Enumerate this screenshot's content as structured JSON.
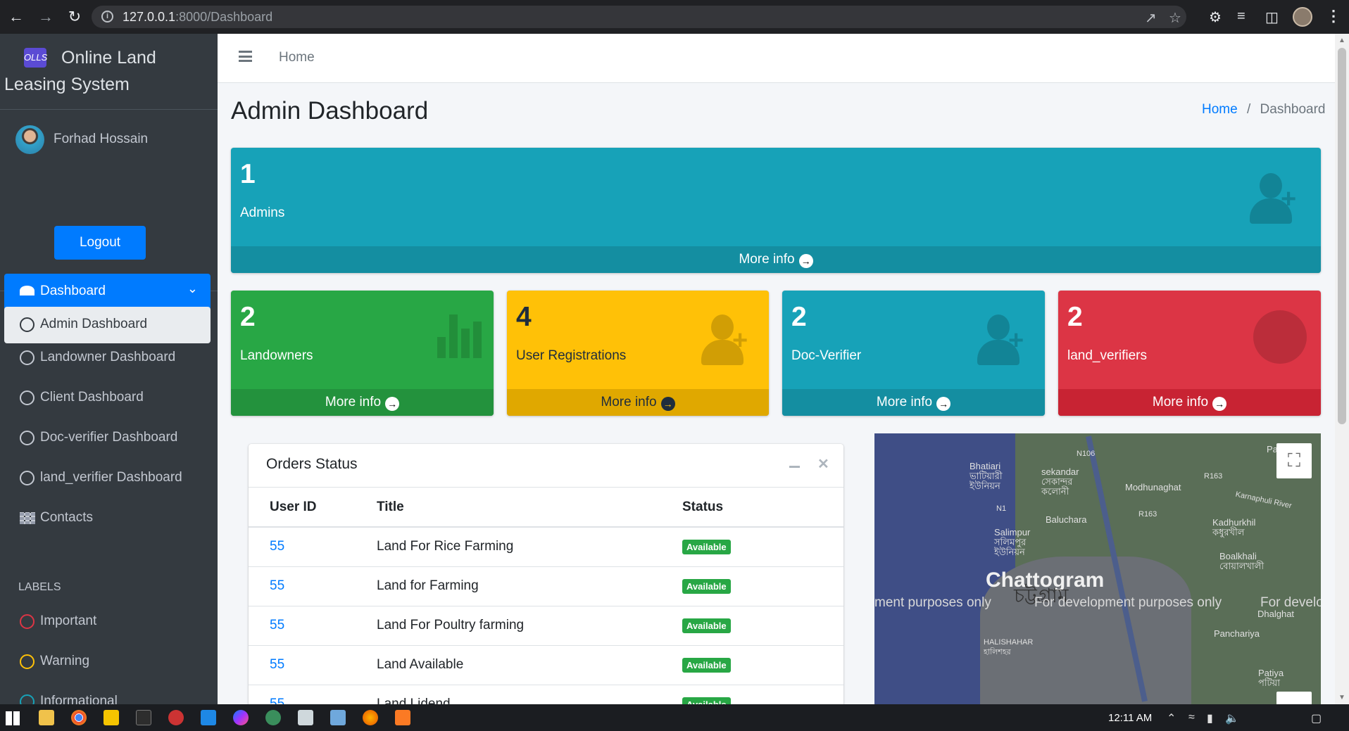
{
  "browser": {
    "url_host": "127.0.0.1",
    "url_rest": ":8000/Dashboard"
  },
  "brand": {
    "logo_text": "OLLS",
    "title_line1": "Online Land",
    "title_line2": "Leasing System"
  },
  "user": {
    "name": "Forhad Hossain",
    "logout_label": "Logout"
  },
  "sidebar": {
    "dashboard_label": "Dashboard",
    "items": [
      {
        "label": "Admin Dashboard"
      },
      {
        "label": "Landowner Dashboard"
      },
      {
        "label": "Client Dashboard"
      },
      {
        "label": "Doc-verifier Dashboard"
      },
      {
        "label": "land_verifier Dashboard"
      },
      {
        "label": "Contacts"
      }
    ],
    "labels_header": "LABELS",
    "labels": [
      {
        "label": "Important",
        "color": "#dc3545"
      },
      {
        "label": "Warning",
        "color": "#ffc107"
      },
      {
        "label": "Informational",
        "color": "#17a2b8"
      }
    ]
  },
  "topnav": {
    "home": "Home"
  },
  "page": {
    "title": "Admin Dashboard",
    "breadcrumb_home": "Home",
    "breadcrumb_sep": "/",
    "breadcrumb_current": "Dashboard"
  },
  "boxes": {
    "more_info": "More info",
    "admins": {
      "count": "1",
      "label": "Admins",
      "color": "#17a2b8"
    },
    "landowners": {
      "count": "2",
      "label": "Landowners",
      "color": "#28a745"
    },
    "registrations": {
      "count": "4",
      "label": "User Registrations",
      "color": "#ffc107"
    },
    "docverifier": {
      "count": "2",
      "label": "Doc-Verifier",
      "color": "#17a2b8"
    },
    "landverifiers": {
      "count": "2",
      "label": "land_verifiers",
      "color": "#dc3545"
    }
  },
  "orders": {
    "title": "Orders Status",
    "columns": [
      "User ID",
      "Title",
      "Status"
    ],
    "rows": [
      {
        "user_id": "55",
        "title": "Land For Rice Farming",
        "status": "Available"
      },
      {
        "user_id": "55",
        "title": "Land for Farming",
        "status": "Available"
      },
      {
        "user_id": "55",
        "title": "Land For Poultry farming",
        "status": "Available"
      },
      {
        "user_id": "55",
        "title": "Land Available",
        "status": "Available"
      },
      {
        "user_id": "55",
        "title": "Land Lidend",
        "status": "Available"
      }
    ]
  },
  "map": {
    "city": "Chattogram",
    "city_local": "চট্টগ্রাম",
    "dev_notice_1": "ment purposes only",
    "dev_notice_2": "For development purposes only",
    "dev_notice_3": "For develo",
    "places": {
      "bhatiari": "Bhatiari\nভাটিয়ারী\nইউনিয়ন",
      "sekandar": "sekandar\nসেকান্দর\nকলোনী",
      "modhunaghat": "Modhunaghat",
      "baluchara": "Baluchara",
      "salimpur": "Salimpur\nসলিমপুর\nইউনিয়ন",
      "kadhurkhil": "Kadhurkhil\nকধুরখীল",
      "boalkhali": "Boalkhali\nবোয়ালখালী",
      "dhalghat": "Dhalghat",
      "pancharia": "Panchariya",
      "halishahar": "HALISHAHAR\nহালিশহর",
      "patiya": "Patiya\nপটিয়া",
      "pal": "Pal",
      "n106": "N106",
      "r163": "R163",
      "n1": "N1",
      "karnaphuli": "Karnaphuli River"
    }
  },
  "taskbar": {
    "clock": "12:11 AM"
  }
}
